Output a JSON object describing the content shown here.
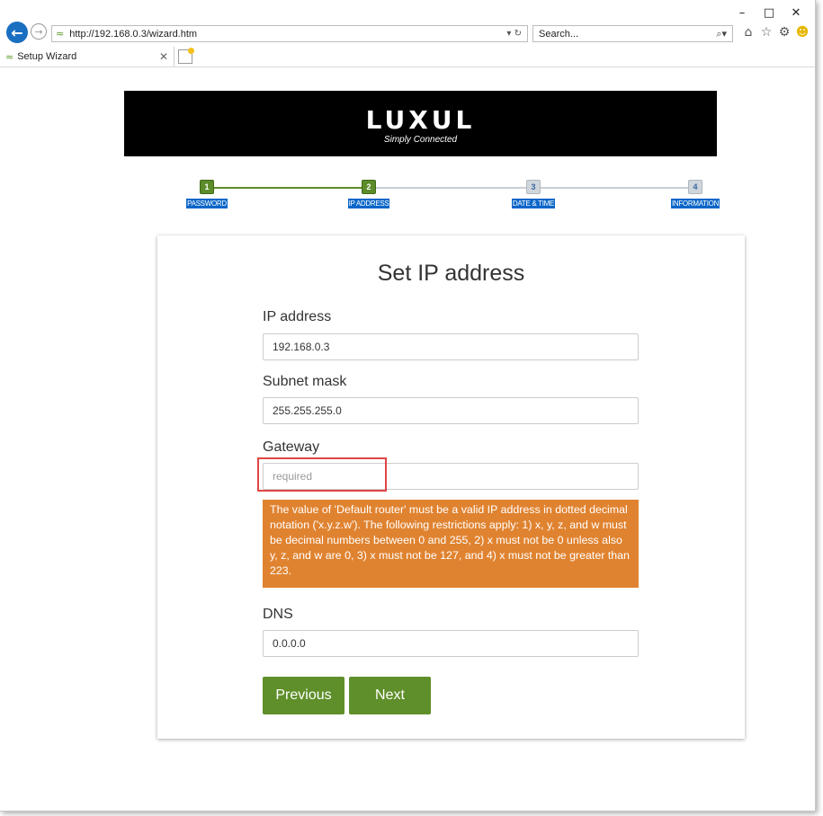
{
  "browser": {
    "url": "http://192.168.0.3/wizard.htm",
    "search_placeholder": "Search...",
    "tab_title": "Setup Wizard"
  },
  "banner": {
    "logo": "LUXUL",
    "tagline": "Simply Connected"
  },
  "steps": [
    {
      "number": "1",
      "label": "PASSWORD",
      "status": "done"
    },
    {
      "number": "2",
      "label": "IP ADDRESS",
      "status": "current"
    },
    {
      "number": "3",
      "label": "DATE & TIME",
      "status": "todo"
    },
    {
      "number": "4",
      "label": "INFORMATION",
      "status": "todo"
    }
  ],
  "form": {
    "title": "Set IP address",
    "ip_label": "IP address",
    "ip_value": "192.168.0.3",
    "subnet_label": "Subnet mask",
    "subnet_value": "255.255.255.0",
    "gateway_label": "Gateway",
    "gateway_value": "",
    "gateway_placeholder": "required",
    "error_message": "The value of 'Default router' must be a valid IP address in dotted decimal notation ('x.y.z.w'). The following restrictions apply: 1) x, y, z, and w must be decimal numbers between 0 and 255, 2) x must not be 0 unless also y, z, and w are 0, 3) x must not be 127, and 4) x must not be greater than 223.",
    "dns_label": "DNS",
    "dns_value": "0.0.0.0",
    "previous_label": "Previous",
    "next_label": "Next"
  },
  "colors": {
    "accent_green": "#5f8f2a",
    "error_orange": "#e08330",
    "step_label_blue": "#0a66c8",
    "highlight_red": "#e04545"
  }
}
